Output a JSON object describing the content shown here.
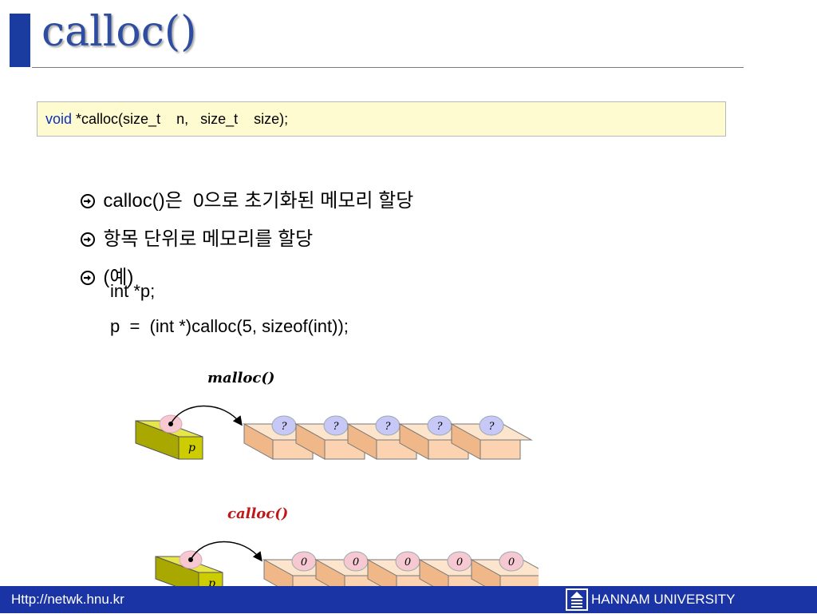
{
  "slide": {
    "title": "calloc()"
  },
  "prototype": {
    "keyword": "void",
    "signature": " *calloc(size_t    n,   size_t    size);"
  },
  "bullets": [
    "calloc()은  0으로 초기화된 메모리 할당",
    "항목 단위로 메모리를 할당",
    "(예)"
  ],
  "code": [
    "int *p;",
    "p  =  (int *)calloc(5, sizeof(int));"
  ],
  "diagram": {
    "malloc_label": "malloc()",
    "calloc_label": "calloc()",
    "pointer_label": "p",
    "malloc_cells": [
      "?",
      "?",
      "?",
      "?",
      "?"
    ],
    "calloc_cells": [
      "0",
      "0",
      "0",
      "0",
      "0"
    ]
  },
  "footer": {
    "link": "Http://netwk.hnu.kr",
    "university": "HANNAM  UNIVERSITY"
  },
  "colors": {
    "accent": "#1a3ca0",
    "footer": "#1a34a6",
    "pointer_box": "#cccc00",
    "memory_cell": "#fcd3b0",
    "malloc_bubble": "#c8c8f8",
    "calloc_bubble": "#f6c8d2"
  }
}
